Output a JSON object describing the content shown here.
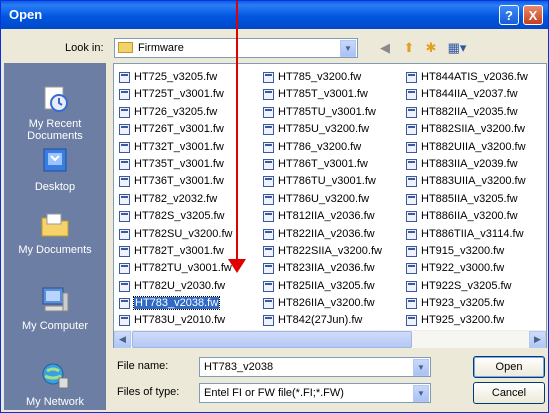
{
  "window": {
    "title": "Open",
    "help_label": "?",
    "close_label": "X"
  },
  "toolbar": {
    "look_in_label": "Look in:",
    "look_in_value": "Firmware",
    "back_icon": "back-arrow-icon",
    "up_icon": "up-folder-icon",
    "new_folder_icon": "new-folder-icon",
    "views_icon": "views-menu-icon"
  },
  "places": [
    {
      "label": "My Recent\nDocuments",
      "icon": "recent-documents-icon"
    },
    {
      "label": "Desktop",
      "icon": "desktop-icon"
    },
    {
      "label": "My Documents",
      "icon": "my-documents-icon"
    },
    {
      "label": "My Computer",
      "icon": "my-computer-icon"
    },
    {
      "label": "My Network",
      "icon": "my-network-icon"
    }
  ],
  "files": {
    "col1": [
      "HT725_v3205.fw",
      "HT725T_v3001.fw",
      "HT726_v3205.fw",
      "HT726T_v3001.fw",
      "HT732T_v3001.fw",
      "HT735T_v3001.fw",
      "HT736T_v3001.fw",
      "HT782_v2032.fw",
      "HT782S_v3205.fw",
      "HT782SU_v3200.fw",
      "HT782T_v3001.fw",
      "HT782TU_v3001.fw",
      "HT782U_v2030.fw",
      "HT783_v2038.fw",
      "HT783U_v2010.fw"
    ],
    "col2": [
      "HT785_v3200.fw",
      "HT785T_v3001.fw",
      "HT785TU_v3001.fw",
      "HT785U_v3200.fw",
      "HT786_v3200.fw",
      "HT786T_v3001.fw",
      "HT786TU_v3001.fw",
      "HT786U_v3200.fw",
      "HT812IIA_v2036.fw",
      "HT822IIA_v2036.fw",
      "HT822SIIA_v3200.fw",
      "HT823IIA_v2036.fw",
      "HT825IIA_v3205.fw",
      "HT826IIA_v3200.fw",
      "HT842(27Jun).fw"
    ],
    "col3": [
      "HT844ATIS_v2036.fw",
      "HT844IIA_v2037.fw",
      "HT882IIA_v2035.fw",
      "HT882SIIA_v3200.fw",
      "HT882UIIA_v3200.fw",
      "HT883IIA_v2039.fw",
      "HT883UIIA_v3200.fw",
      "HT885IIA_v3205.fw",
      "HT886IIA_v3200.fw",
      "HT886TIIA_v3114.fw",
      "HT915_v3200.fw",
      "HT922_v3000.fw",
      "HT922S_v3205.fw",
      "HT923_v3205.fw",
      "HT925_v3200.fw"
    ],
    "selected": "HT783_v2038.fw"
  },
  "form": {
    "file_name_label": "File name:",
    "file_name_value": "HT783_v2038",
    "file_type_label": "Files of type:",
    "file_type_value": "Entel FI or FW file(*.FI;*.FW)",
    "open_label": "Open",
    "cancel_label": "Cancel"
  },
  "colors": {
    "title_bar": "#0054e3",
    "places_bar": "#6d7ea4",
    "selection": "#316ac5",
    "annotation_arrow": "#e00000"
  }
}
